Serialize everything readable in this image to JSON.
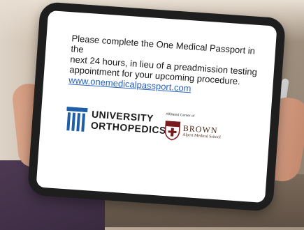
{
  "screen": {
    "message_line1": "Please complete the One Medical Passport in the",
    "message_line2": "next 24 hours, in lieu of a preadmission testing",
    "message_line3": "appointment for your upcoming procedure.",
    "link_text": "www.onemedicalpassport.com"
  },
  "logos": {
    "university_orthopedics": {
      "line1": "UNIVERSITY",
      "line2": "ORTHOPEDICS",
      "color": "#1f5fa8"
    },
    "brown": {
      "affiliation": "Affiliated Center of",
      "name": "BROWN",
      "subtitle": "Alpert Medical School",
      "color": "#7a1a1a"
    }
  },
  "colors": {
    "link": "#2b63b8",
    "tablet_bezel": "#1e1e1e"
  }
}
